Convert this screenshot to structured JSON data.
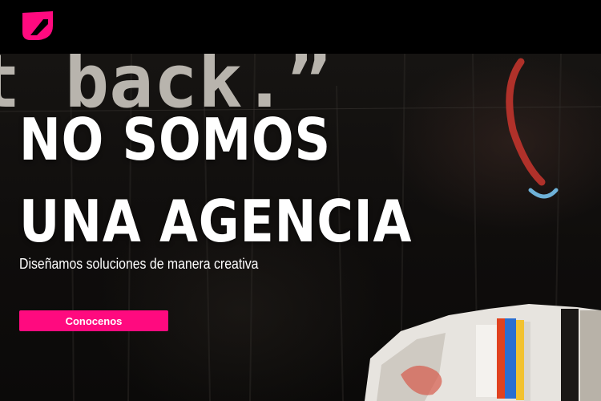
{
  "brand": {
    "logo_icon": "brand-logo-icon",
    "accent": "#ff0a7f"
  },
  "hero": {
    "background_text": "t back.”",
    "headline": [
      "NO SOMOS",
      "UNA AGENCIA"
    ],
    "subtitle": "Diseñamos soluciones de manera creativa",
    "cta_label": "Conocenos"
  }
}
